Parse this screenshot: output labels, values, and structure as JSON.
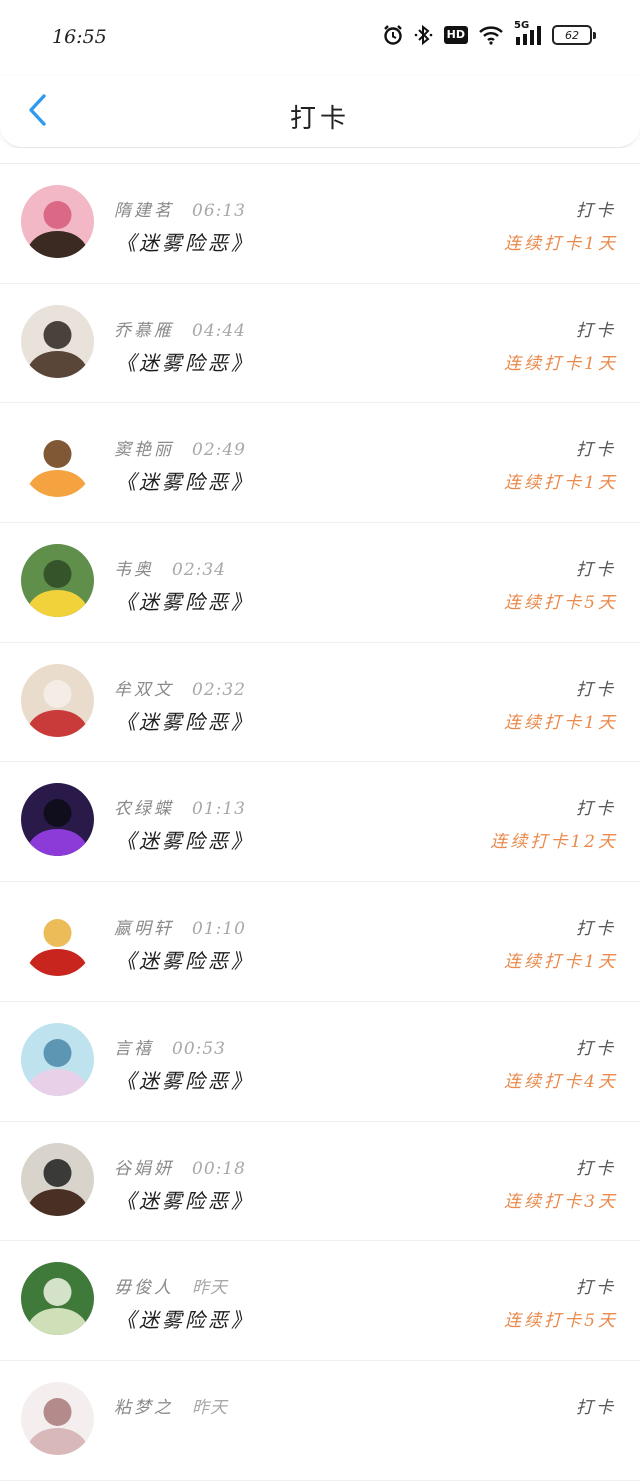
{
  "status_bar": {
    "time": "16:55",
    "hd": "HD",
    "network": "5G",
    "battery": "62"
  },
  "header": {
    "title": "打卡"
  },
  "colors": {
    "streak": "#e98a4c",
    "back_arrow": "#2e9bf0"
  },
  "rows": [
    {
      "name": "隋建茗",
      "time": "06:13",
      "book": "《迷雾险恶》",
      "label": "打卡",
      "streak": "连续打卡1天",
      "avatar_icon": "avatar-woman-pink-photo",
      "avatar_colors": [
        "#f2b8c6",
        "#3b2a22",
        "#d75a7a"
      ]
    },
    {
      "name": "乔慕雁",
      "time": "04:44",
      "book": "《迷雾险恶》",
      "label": "打卡",
      "streak": "连续打卡1天",
      "avatar_icon": "avatar-child-with-dog",
      "avatar_colors": [
        "#e8e2da",
        "#5a4638",
        "#2c2420"
      ]
    },
    {
      "name": "窦艳丽",
      "time": "02:49",
      "book": "《迷雾险恶》",
      "label": "打卡",
      "streak": "连续打卡1天",
      "avatar_icon": "avatar-cartoon-tiger",
      "avatar_colors": [
        "#ffffff",
        "#f4a340",
        "#6a3b12"
      ]
    },
    {
      "name": "韦奥",
      "time": "02:34",
      "book": "《迷雾险恶》",
      "label": "打卡",
      "streak": "连续打卡5天",
      "avatar_icon": "avatar-girls-sunflowers",
      "avatar_colors": [
        "#5f8f4a",
        "#f2d23a",
        "#2f4a24"
      ]
    },
    {
      "name": "牟双文",
      "time": "02:32",
      "book": "《迷雾险恶》",
      "label": "打卡",
      "streak": "连续打卡1天",
      "avatar_icon": "avatar-woman-red-white",
      "avatar_colors": [
        "#e9dccc",
        "#c93a3a",
        "#f4f0ea"
      ]
    },
    {
      "name": "农绿蝶",
      "time": "01:13",
      "book": "《迷雾险恶》",
      "label": "打卡",
      "streak": "连续打卡12天",
      "avatar_icon": "avatar-man-purple-light",
      "avatar_colors": [
        "#2a1a4a",
        "#8c3ad8",
        "#0c0c14"
      ]
    },
    {
      "name": "嬴明轩",
      "time": "01:10",
      "book": "《迷雾险恶》",
      "label": "打卡",
      "streak": "连续打卡1天",
      "avatar_icon": "avatar-red-phoenix-emblem",
      "avatar_colors": [
        "#ffffff",
        "#c8251e",
        "#e8b03a"
      ]
    },
    {
      "name": "言禧",
      "time": "00:53",
      "book": "《迷雾险恶》",
      "label": "打卡",
      "streak": "连续打卡4天",
      "avatar_icon": "avatar-anime-girl",
      "avatar_colors": [
        "#bfe3ee",
        "#e8d0e8",
        "#4a88a8"
      ]
    },
    {
      "name": "谷娟妍",
      "time": "00:18",
      "book": "《迷雾险恶》",
      "label": "打卡",
      "streak": "连续打卡3天",
      "avatar_icon": "avatar-boy-portrait",
      "avatar_colors": [
        "#d8d4cc",
        "#4a3024",
        "#1e1e1e"
      ]
    },
    {
      "name": "毋俊人",
      "time": "昨天",
      "book": "《迷雾险恶》",
      "label": "打卡",
      "streak": "连续打卡5天",
      "avatar_icon": "avatar-garden-figure",
      "avatar_colors": [
        "#3f7a3a",
        "#cfe0b8",
        "#eef4e4"
      ]
    },
    {
      "name": "粘梦之",
      "time": "昨天",
      "book": "",
      "label": "打卡",
      "streak": "",
      "avatar_icon": "avatar-ink-drawing",
      "avatar_colors": [
        "#f4eeee",
        "#d8b8b8",
        "#a87878"
      ]
    }
  ]
}
